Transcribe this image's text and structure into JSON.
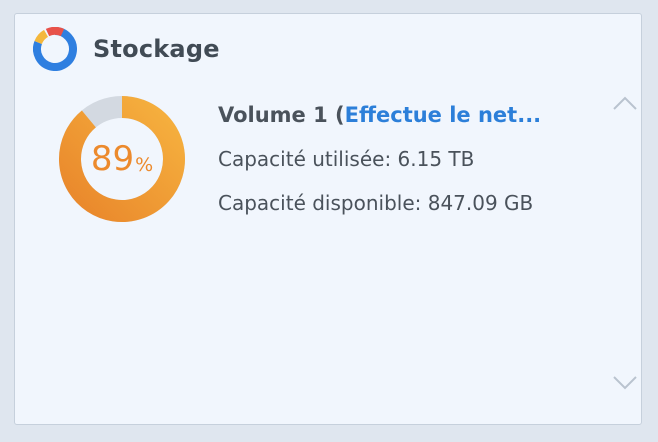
{
  "widget": {
    "title": "Stockage",
    "icon": "storage-donut-icon"
  },
  "volume": {
    "name_prefix": "Volume 1 (",
    "status": "Effectue le net...",
    "usage_percent": 89,
    "usage_percent_text": "89",
    "percent_sign": "%",
    "used_line": "Capacité utilisée: 6.15 TB",
    "available_line": "Capacité disponible: 847.09 GB"
  },
  "colors": {
    "used_light": "#f6b23f",
    "used_dark": "#e9862b",
    "free": "#d3d9e1",
    "status_link": "#2c7fd9",
    "percent_text": "#ec8a2d"
  },
  "controls": {
    "scroll_up": "chevron-up-icon",
    "scroll_down": "chevron-down-icon"
  }
}
